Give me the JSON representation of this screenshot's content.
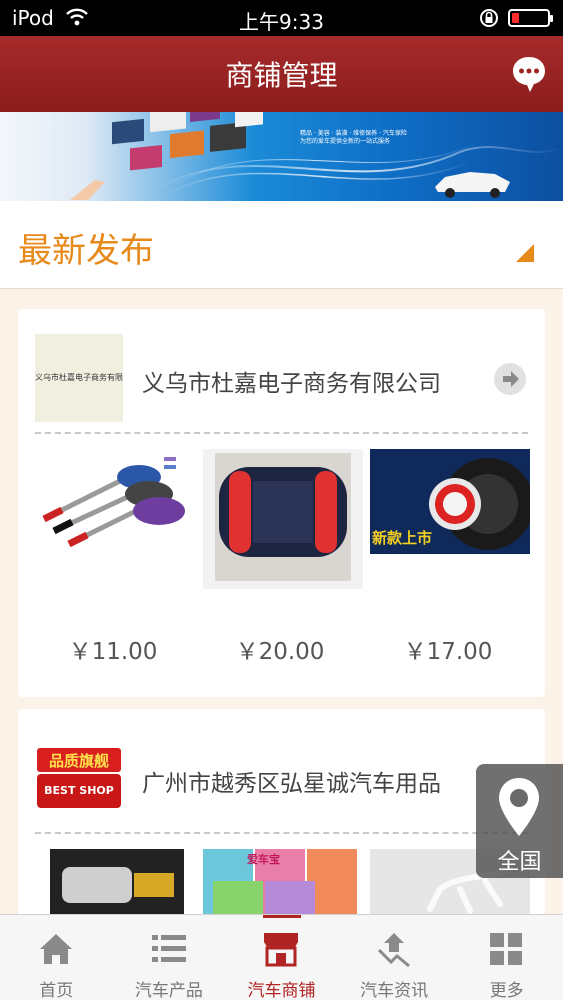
{
  "status_bar": {
    "carrier": "iPod",
    "time": "上午9:33",
    "battery_level": 0.2,
    "battery_color": "#ff2d2d"
  },
  "header": {
    "title": "商铺管理",
    "chat_icon": "chat-bubble-icon",
    "background": "#9a2323"
  },
  "banner": {
    "text_line": "精品 · 美容 · 装潢 · 维修保养 · 汽车保险",
    "text_line_2": "为您的爱车提供全新的一站式服务"
  },
  "section": {
    "title": "最新发布",
    "accent": "#e8891c"
  },
  "shops": [
    {
      "name": "义乌市杜嘉电子商务有限公司",
      "logo_text": "义乌市杜嘉电子商务有限公司",
      "products": [
        {
          "name": "car-wash-mop",
          "price": "￥11.00"
        },
        {
          "name": "lumbar-cushion",
          "price": "￥20.00"
        },
        {
          "name": "tire-inflator",
          "price": "￥17.00",
          "label": "新款上市"
        }
      ]
    },
    {
      "name": "广州市越秀区弘星诚汽车用品",
      "logo_text": "品质旗舰",
      "logo_sub": "BEST SHOP",
      "products": [
        {
          "name": "car-vacuum"
        },
        {
          "name": "air-freshener",
          "label": "爱车宝"
        },
        {
          "name": "gecko-decor"
        }
      ]
    }
  ],
  "location_button": {
    "label": "全国",
    "icon": "map-pin-icon"
  },
  "tabs": [
    {
      "label": "首页",
      "icon": "home-icon",
      "active": false
    },
    {
      "label": "汽车产品",
      "icon": "list-icon",
      "active": false
    },
    {
      "label": "汽车商铺",
      "icon": "store-icon",
      "active": true
    },
    {
      "label": "汽车资讯",
      "icon": "news-icon",
      "active": false
    },
    {
      "label": "更多",
      "icon": "grid-icon",
      "active": false
    }
  ]
}
